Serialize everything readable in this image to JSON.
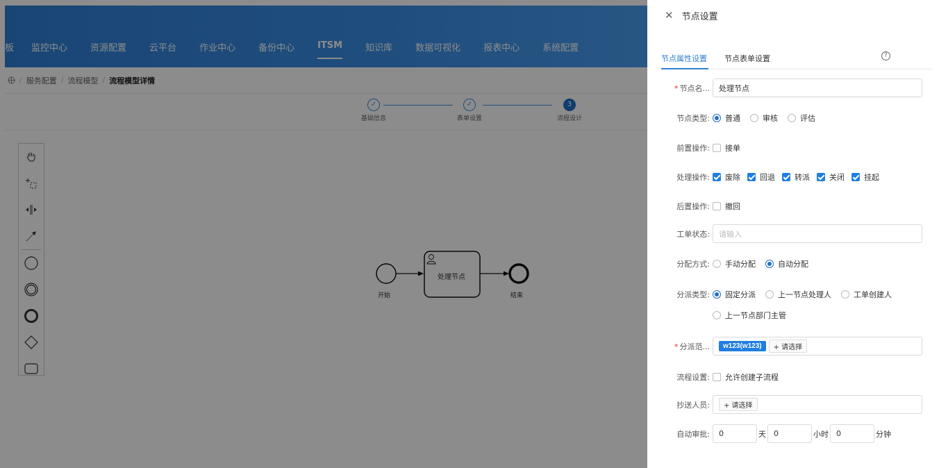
{
  "nav": {
    "items": [
      "板",
      "监控中心",
      "资源配置",
      "云平台",
      "作业中心",
      "备份中心",
      "ITSM",
      "知识库",
      "数据可视化",
      "报表中心",
      "系统配置"
    ],
    "active_index": 6
  },
  "breadcrumb": {
    "items": [
      "服务配置",
      "流程模型"
    ],
    "current": "流程模型详情"
  },
  "steps": [
    {
      "label": "基础信息",
      "status": "done"
    },
    {
      "label": "表单设置",
      "status": "done"
    },
    {
      "label": "流程设计",
      "status": "current",
      "number": "3"
    }
  ],
  "palette": [
    "hand-tool",
    "lasso-tool",
    "space-tool",
    "connect-tool",
    "start-event",
    "intermediate-event",
    "end-event",
    "gateway",
    "task"
  ],
  "diagram": {
    "start_label": "开始",
    "task_label": "处理节点",
    "end_label": "结束"
  },
  "drawer": {
    "title": "节点设置",
    "tabs": [
      "节点属性设置",
      "节点表单设置"
    ],
    "active_tab": 0,
    "help_glyph": "?",
    "fields": {
      "node_name": {
        "label": "节点名...",
        "value": "处理节点"
      },
      "node_type": {
        "label": "节点类型:",
        "options": [
          "普通",
          "审核",
          "评估"
        ],
        "selected": 0
      },
      "pre_op": {
        "label": "前置操作:",
        "options": [
          "接单"
        ],
        "checked": [
          false
        ]
      },
      "process_op": {
        "label": "处理操作:",
        "options": [
          "废除",
          "回退",
          "转派",
          "关闭",
          "挂起"
        ],
        "checked": [
          true,
          true,
          true,
          true,
          true
        ]
      },
      "post_op": {
        "label": "后置操作:",
        "options": [
          "撤回"
        ],
        "checked": [
          false
        ]
      },
      "ticket_status": {
        "label": "工单状态:",
        "placeholder": "请输入"
      },
      "assign_mode": {
        "label": "分配方式:",
        "options": [
          "手动分配",
          "自动分配"
        ],
        "selected": 1
      },
      "dispatch_type": {
        "label": "分派类型:",
        "options": [
          "固定分派",
          "上一节点处理人",
          "工单创建人",
          "上一节点部门主管"
        ],
        "selected": 0
      },
      "dispatch_scope": {
        "label": "分派范...",
        "tag": "w123(w123)",
        "add_label": "+ 请选择"
      },
      "flow_setting": {
        "label": "流程设置:",
        "options": [
          "允许创建子流程"
        ],
        "checked": [
          false
        ]
      },
      "cc": {
        "label": "抄送人员:",
        "add_label": "+ 请选择"
      },
      "auto_approve": {
        "label": "自动审批:",
        "days": "0",
        "day_unit": "天",
        "hours": "0",
        "hour_unit": "小时",
        "minutes": "0",
        "minute_unit": "分钟"
      }
    }
  }
}
